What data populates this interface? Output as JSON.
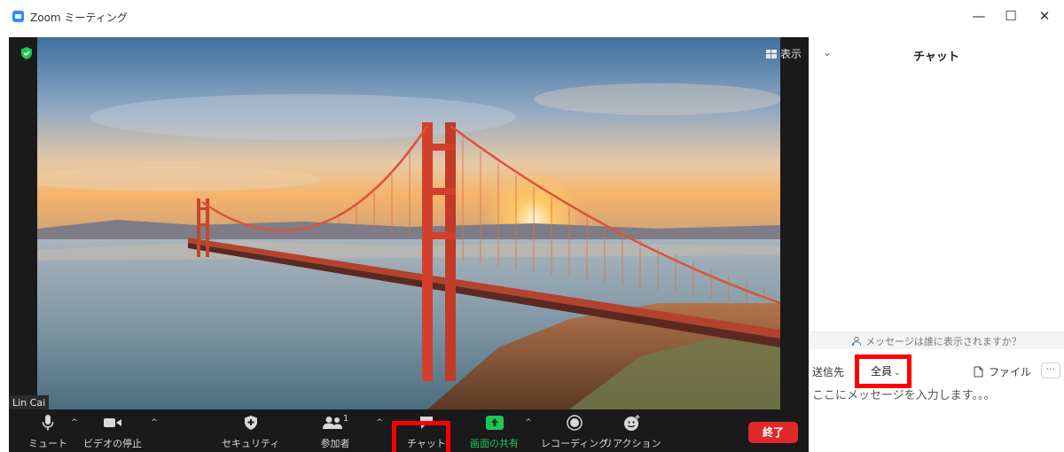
{
  "window": {
    "title": "Zoom ミーティング",
    "minimize_glyph": "—",
    "maximize_glyph": "☐",
    "close_glyph": "✕"
  },
  "video": {
    "view_button_label": "表示",
    "participant_name": "Lin Cai",
    "shield_color": "#1fc655"
  },
  "toolbar": {
    "mute_label": "ミュート",
    "video_label": "ビデオの停止",
    "security_label": "セキュリティ",
    "participants_label": "参加者",
    "participants_count": "1",
    "chat_label": "チャット",
    "share_label": "画面の共有",
    "record_label": "レコーディング",
    "reactions_label": "リアクション",
    "end_label": "終了",
    "caret_glyph": "^",
    "share_color": "#1fc655",
    "end_color": "#e02828"
  },
  "chat": {
    "title": "チャット",
    "collapse_glyph": "⌄",
    "who_sees_text": "メッセージは誰に表示されますか？",
    "send_to_label": "送信先",
    "recipient_value": "全員",
    "recipient_chevron": "⌄",
    "file_label": "ファイル",
    "more_glyph": "···",
    "input_placeholder": "ここにメッセージを入力します。。。"
  },
  "annotations": {
    "highlight_color": "#ff0000"
  }
}
